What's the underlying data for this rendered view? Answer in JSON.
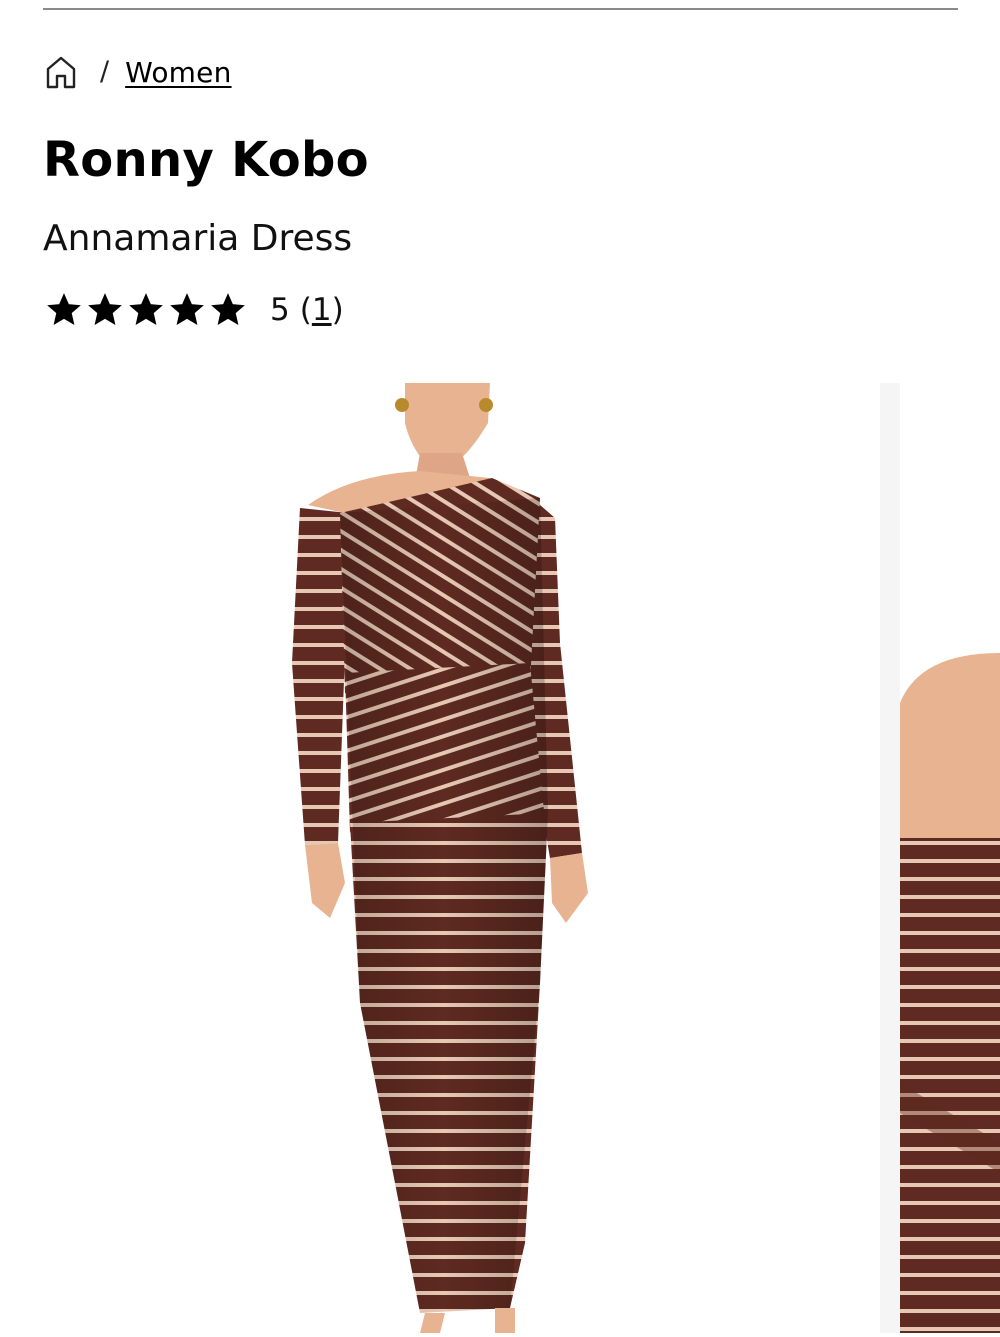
{
  "breadcrumb": {
    "home_icon": "home-icon",
    "separator": "/",
    "category": "Women"
  },
  "product": {
    "brand": "Ronny Kobo",
    "name": "Annamaria Dress",
    "rating": {
      "stars_filled": 5,
      "stars_total": 5,
      "score": "5",
      "count": "1"
    }
  },
  "gallery": {
    "main_image_alt": "Model wearing a brown and cream striped off-shoulder long sleeve maxi dress",
    "next_image_alt": "Close-up of striped dress fabric at the shoulder"
  },
  "colors": {
    "dress_base": "#5e2a21",
    "dress_stripe": "#e6c8b4",
    "skin": "#e7b391",
    "rule": "#8a8a8a"
  }
}
